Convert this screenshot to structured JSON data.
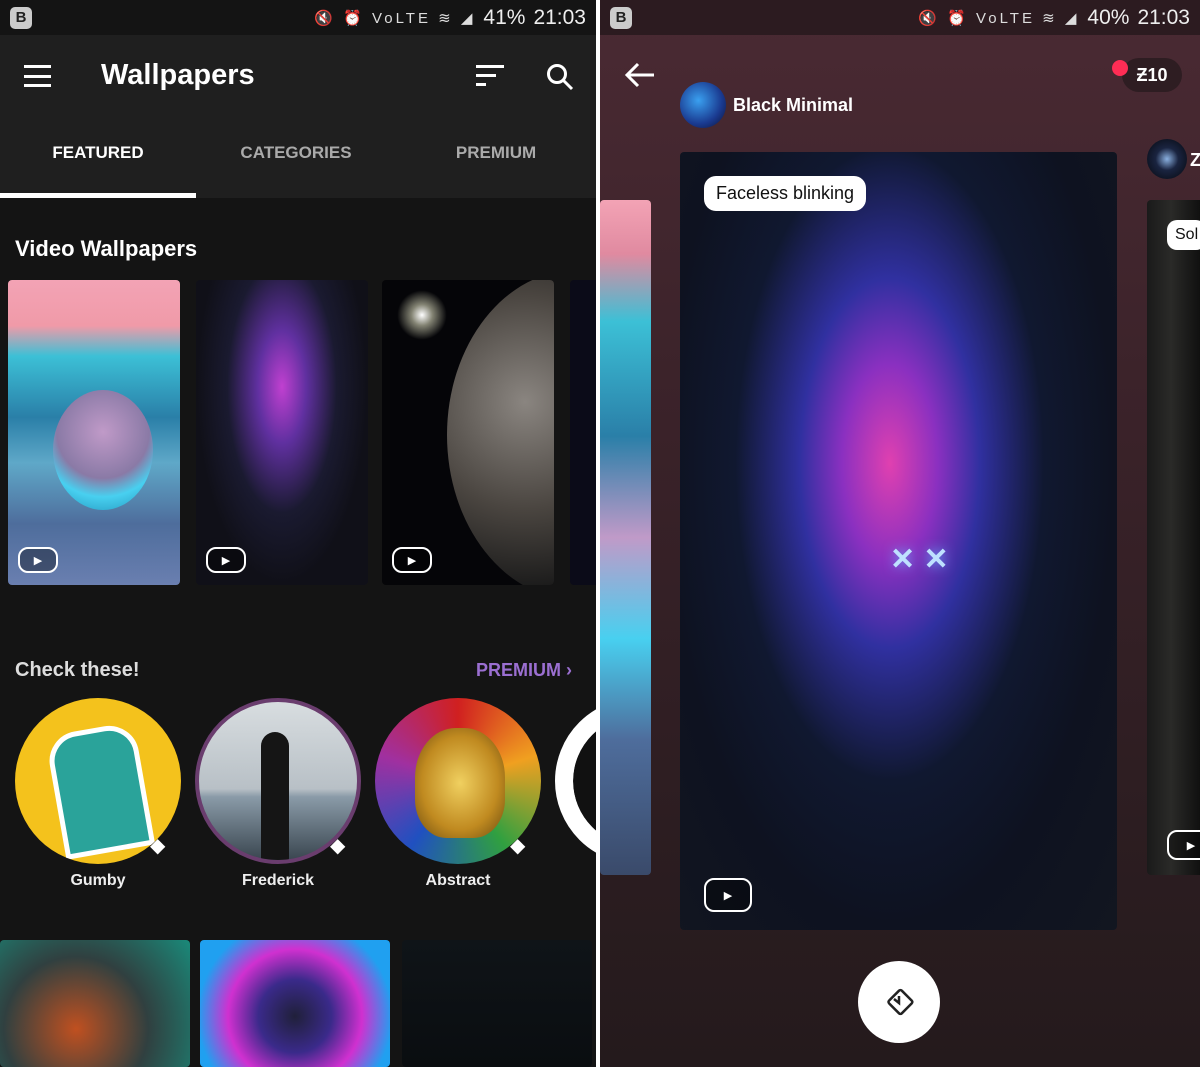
{
  "left": {
    "status": {
      "badge": "B",
      "icons": "🔇 ⏰ VoLTE ≋ ◢",
      "battery": "41%",
      "time": "21:03"
    },
    "toolbar": {
      "title": "Wallpapers"
    },
    "tabs": [
      {
        "label": "FEATURED",
        "active": true
      },
      {
        "label": "CATEGORIES"
      },
      {
        "label": "PREMIUM"
      }
    ],
    "video_section": {
      "title": "Video Wallpapers",
      "cards": [
        "crystal-ball-beach",
        "neon-flame-face",
        "earth-from-space",
        "dark-partial"
      ]
    },
    "check_section": {
      "title": "Check these!",
      "link": "PREMIUM",
      "items": [
        {
          "label": "Gumby"
        },
        {
          "label": "Frederick"
        },
        {
          "label": "Abstract"
        }
      ]
    }
  },
  "right": {
    "status": {
      "badge": "B",
      "icons": "🔇 ⏰ VoLTE ≋ ◢",
      "battery": "40%",
      "time": "21:03"
    },
    "collection": "Black Minimal",
    "credits": "Ƶ10",
    "card_title": "Faceless blinking",
    "next_peek_label": "Sol",
    "next_peek_author": "Z"
  },
  "colors": {
    "accent": "#9b6fd1",
    "notification": "#ff2d55"
  }
}
